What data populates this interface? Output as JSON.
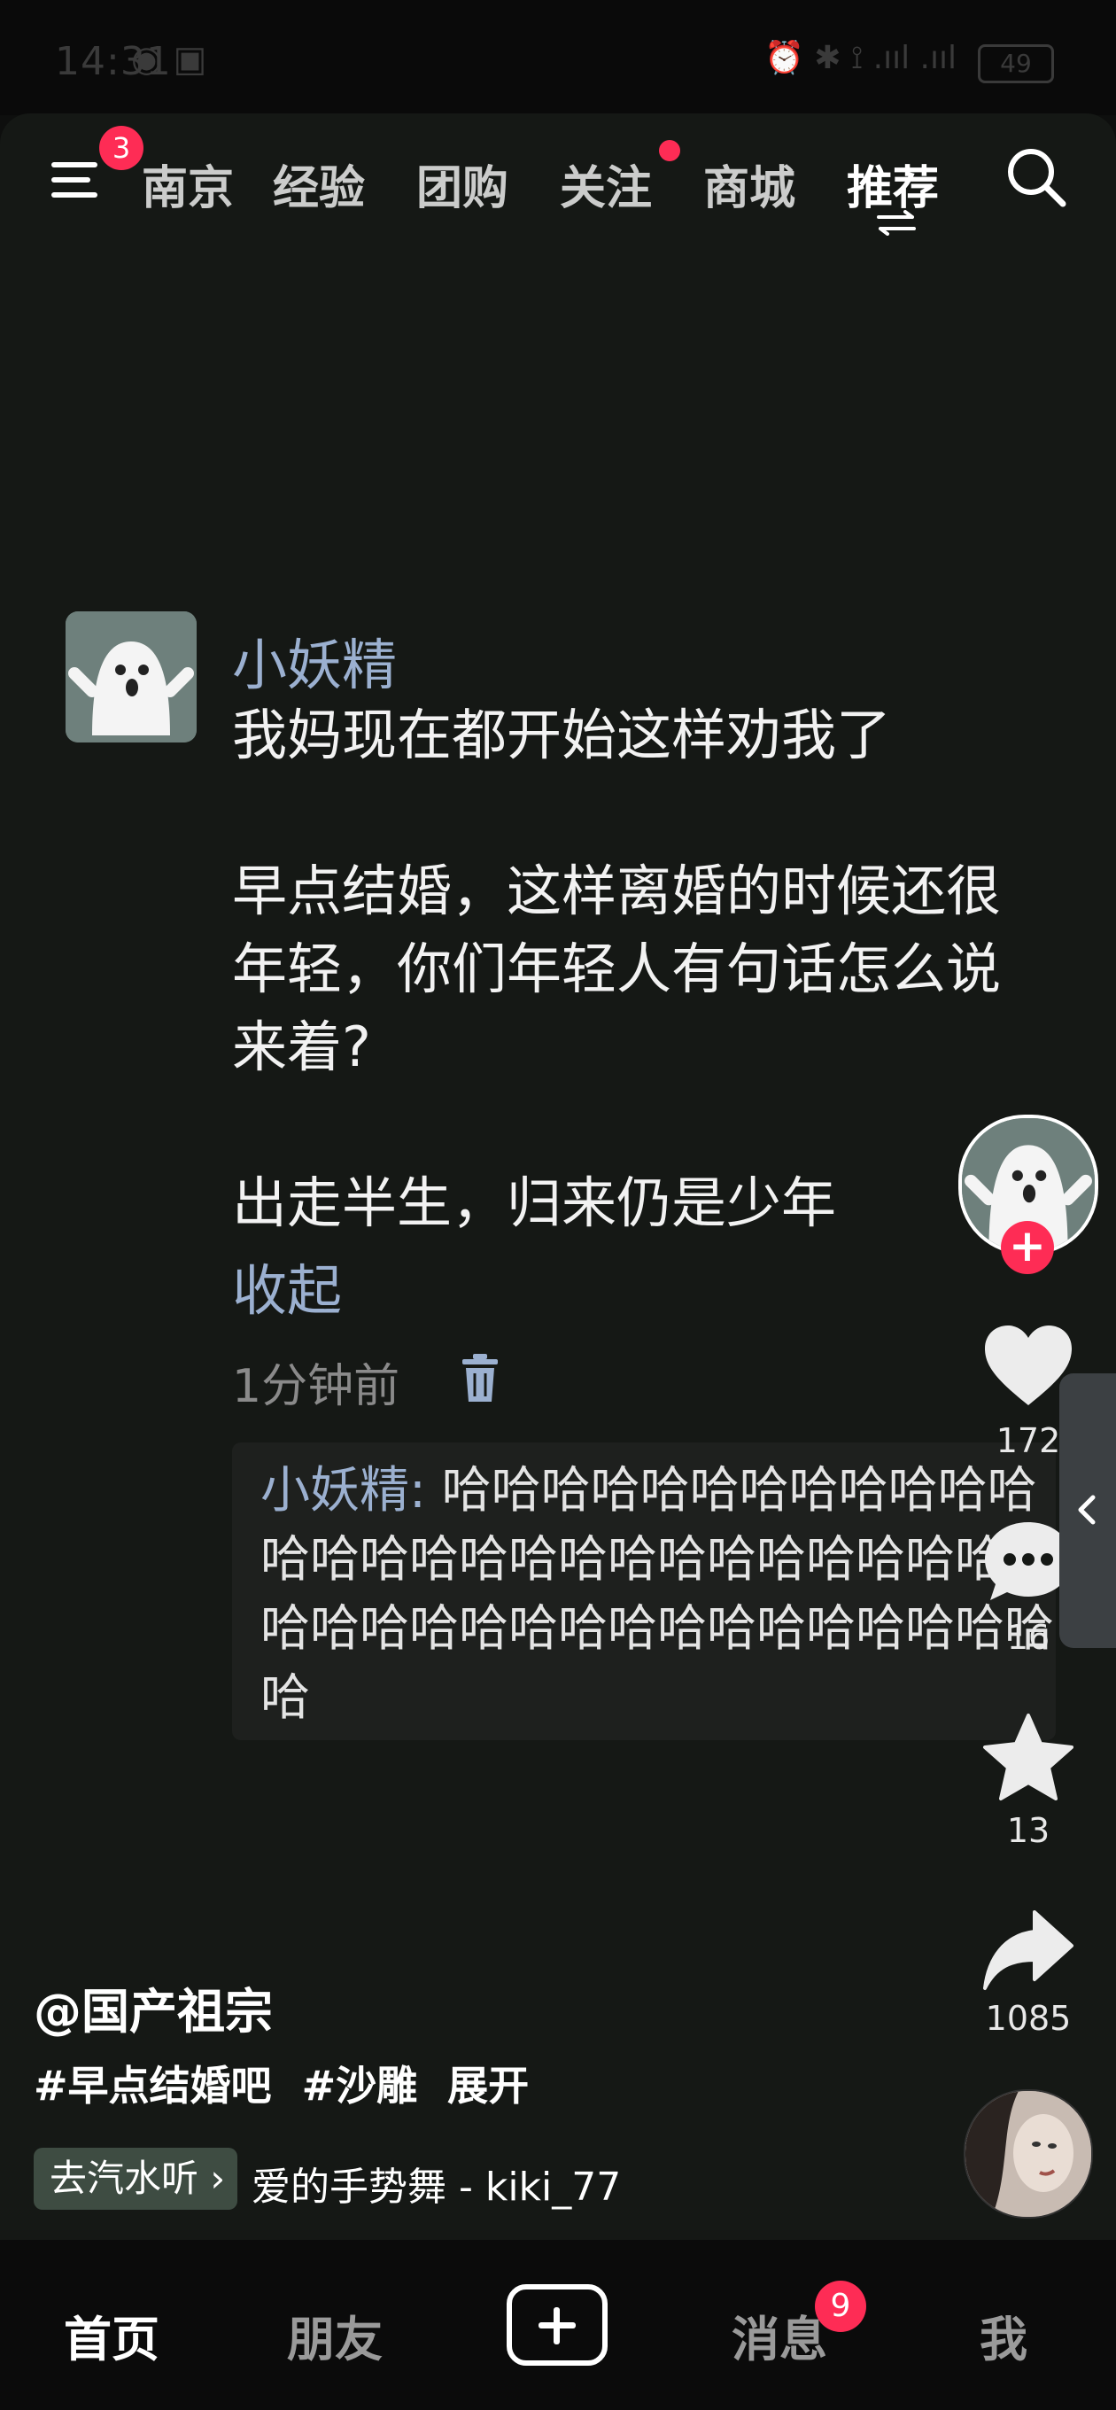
{
  "status_bar": {
    "time": "14:31",
    "battery": "49"
  },
  "top_nav": {
    "menu_badge": "3",
    "tabs": [
      "南京",
      "经验",
      "团购",
      "关注",
      "商城",
      "推荐"
    ]
  },
  "comment": {
    "user": "小妖精",
    "text": "我妈现在都开始这样劝我了\n\n早点结婚，这样离婚的时候还很年轻，你们年轻人有句话怎么说来着?\n\n出走半生，归来仍是少年",
    "collapse_label": "收起",
    "time": "1分钟前",
    "reply": {
      "user": "小妖精:",
      "text": " 哈哈哈哈哈哈哈哈哈哈哈哈哈哈哈哈哈哈哈哈哈哈哈哈哈哈哈哈哈哈哈哈哈哈哈哈哈哈哈哈哈哈哈哈哈"
    }
  },
  "rail": {
    "likes": "172",
    "comments": "16",
    "favorites": "13",
    "shares": "1085"
  },
  "video_info": {
    "author": "@国产祖宗",
    "tags": [
      "#早点结婚吧",
      "#沙雕"
    ],
    "expand": "展开",
    "music_chip": "去汽水听 ›",
    "music": "爱的手势舞 - kiki_77"
  },
  "bottom_nav": {
    "items": [
      "首页",
      "朋友",
      "消息",
      "我"
    ],
    "message_badge": "9"
  },
  "colors": {
    "accent": "#fe2c55",
    "username": "#9bb0d0",
    "background": "#151815"
  }
}
